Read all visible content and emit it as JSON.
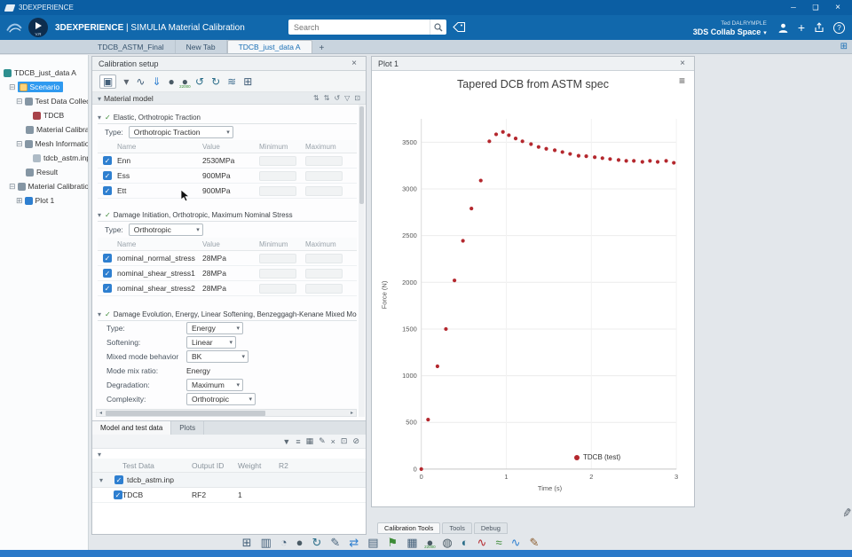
{
  "titlebar": {
    "title": "3DEXPERIENCE"
  },
  "header": {
    "brand": "3DEXPERIENCE",
    "separator": "|",
    "app_name": "SIMULIA Material Calibration",
    "compass_label": "V.R",
    "search_placeholder": "Search",
    "user_name": "Ted DALRYMPLE",
    "space_name": "3DS Collab Space"
  },
  "tabbar": {
    "tabs": [
      {
        "label": "TDCB_ASTM_Final"
      },
      {
        "label": "New Tab"
      },
      {
        "label": "TDCB_just_data A"
      }
    ],
    "new_tab_label": "+"
  },
  "tree": {
    "items": [
      {
        "label": "TDCB_just_data A"
      },
      {
        "label": "Scenario"
      },
      {
        "label": "Test Data Collector..."
      },
      {
        "label": "TDCB"
      },
      {
        "label": "Material Calibration"
      },
      {
        "label": "Mesh Information C..."
      },
      {
        "label": "tdcb_astm.inp"
      },
      {
        "label": "Result"
      },
      {
        "label": "Material Calibration"
      },
      {
        "label": "Plot 1"
      }
    ]
  },
  "calibration": {
    "panel_title": "Calibration setup",
    "toolbar_icons": [
      {
        "name": "view-mode-selector-icon",
        "glyph": "▣",
        "color": "#44607a"
      },
      {
        "name": "view-mode-caret-icon",
        "glyph": "▾",
        "color": "#5d6670"
      },
      {
        "name": "plot-tool-icon",
        "glyph": "∿",
        "color": "#44607a"
      },
      {
        "name": "import-data-icon",
        "glyph": "⇓",
        "color": "#2e7fd0"
      },
      {
        "name": "mesh-sphere-icon",
        "glyph": "●",
        "color": "#4a5b66"
      },
      {
        "name": "mesh-count-icon",
        "glyph": "●",
        "color": "#4a5b66",
        "badge": "22000"
      },
      {
        "name": "undo-icon",
        "glyph": "↺",
        "color": "#2c6e8a"
      },
      {
        "name": "redo-icon",
        "glyph": "↻",
        "color": "#2c6e8a"
      },
      {
        "name": "create-plot-icon",
        "glyph": "≋",
        "color": "#3d6c8e"
      },
      {
        "name": "data-table-icon",
        "glyph": "⊞",
        "color": "#44607a"
      }
    ],
    "material_model_label": "Material model",
    "material_model_icons": [
      {
        "name": "sort-ascending-icon",
        "glyph": "⇅"
      },
      {
        "name": "sort-descending-icon",
        "glyph": "⇅"
      },
      {
        "name": "reset-icon",
        "glyph": "↺"
      },
      {
        "name": "filter-icon",
        "glyph": "▽"
      },
      {
        "name": "copy-icon",
        "glyph": "⊡"
      }
    ],
    "elastic": {
      "title": "Elastic, Orthotropic Traction",
      "type_label": "Type:",
      "type_value": "Orthotropic Traction",
      "columns": [
        "Name",
        "Value",
        "Minimum",
        "Maximum"
      ],
      "rows": [
        {
          "name": "Enn",
          "value": "2530MPa"
        },
        {
          "name": "Ess",
          "value": "900MPa"
        },
        {
          "name": "Ett",
          "value": "900MPa"
        }
      ]
    },
    "damage_initiation": {
      "title": "Damage Initiation, Orthotropic, Maximum Nominal Stress",
      "type_label": "Type:",
      "type_value": "Orthotropic",
      "columns": [
        "Name",
        "Value",
        "Minimum",
        "Maximum"
      ],
      "rows": [
        {
          "name": "nominal_normal_stress",
          "value": "28MPa"
        },
        {
          "name": "nominal_shear_stress1",
          "value": "28MPa"
        },
        {
          "name": "nominal_shear_stress2",
          "value": "28MPa"
        }
      ]
    },
    "damage_evolution": {
      "title": "Damage Evolution, Energy, Linear Softening, Benzeggagh-Kenane Mixed Mode",
      "fields": [
        {
          "label": "Type:",
          "value": "Energy",
          "control": "select"
        },
        {
          "label": "Softening:",
          "value": "Linear",
          "control": "select"
        },
        {
          "label": "Mixed mode behavior",
          "value": "BK",
          "control": "select"
        },
        {
          "label": "Mode mix ratio:",
          "value": "Energy",
          "control": "text"
        },
        {
          "label": "Degradation:",
          "value": "Maximum",
          "control": "select"
        },
        {
          "label": "Complexity:",
          "value": "Orthotropic",
          "control": "select"
        }
      ]
    },
    "subpanel": {
      "tabs": [
        {
          "label": "Model and test data"
        },
        {
          "label": "Plots"
        }
      ],
      "toolbar_icons": [
        {
          "name": "filter-icon",
          "glyph": "▼"
        },
        {
          "name": "list-icon",
          "glyph": "≡"
        },
        {
          "name": "grid-icon",
          "glyph": "▦"
        },
        {
          "name": "edit-icon",
          "glyph": "✎"
        },
        {
          "name": "remove-icon",
          "glyph": "×"
        },
        {
          "name": "copy-icon",
          "glyph": "⊡"
        },
        {
          "name": "delete-icon",
          "glyph": "⊘"
        }
      ],
      "table": {
        "columns": [
          "Test Data",
          "Output ID",
          "Weight",
          "R2"
        ],
        "group_row": {
          "name": "tdcb_astm.inp"
        },
        "rows": [
          {
            "name": "TDCB",
            "output_id": "RF2",
            "weight": "1",
            "r2": ""
          }
        ]
      }
    }
  },
  "plot_panel": {
    "title": "Plot 1"
  },
  "chart_data": {
    "type": "scatter",
    "title": "Tapered DCB from ASTM spec",
    "xlabel": "Time (s)",
    "ylabel": "Force (N)",
    "xlim": [
      0,
      3
    ],
    "ylim": [
      0,
      3750
    ],
    "xticks": [
      0,
      1,
      2,
      3
    ],
    "yticks": [
      0,
      500,
      1000,
      1500,
      2000,
      2500,
      3000,
      3500
    ],
    "grid": true,
    "legend": {
      "position": "inside-bottom",
      "label": "TDCB (test)"
    },
    "series": [
      {
        "name": "TDCB (test)",
        "color": "#b4282e",
        "marker": "circle",
        "points": [
          [
            0,
            0
          ],
          [
            0.08,
            530
          ],
          [
            0.19,
            1100
          ],
          [
            0.29,
            1500
          ],
          [
            0.39,
            2020
          ],
          [
            0.49,
            2445
          ],
          [
            0.59,
            2790
          ],
          [
            0.7,
            3090
          ],
          [
            0.8,
            3510
          ],
          [
            0.88,
            3585
          ],
          [
            0.96,
            3610
          ],
          [
            1.03,
            3575
          ],
          [
            1.11,
            3540
          ],
          [
            1.19,
            3510
          ],
          [
            1.29,
            3480
          ],
          [
            1.38,
            3450
          ],
          [
            1.47,
            3430
          ],
          [
            1.57,
            3415
          ],
          [
            1.66,
            3395
          ],
          [
            1.75,
            3375
          ],
          [
            1.85,
            3355
          ],
          [
            1.94,
            3350
          ],
          [
            2.04,
            3340
          ],
          [
            2.13,
            3330
          ],
          [
            2.22,
            3320
          ],
          [
            2.32,
            3310
          ],
          [
            2.41,
            3300
          ],
          [
            2.5,
            3300
          ],
          [
            2.6,
            3290
          ],
          [
            2.69,
            3300
          ],
          [
            2.78,
            3290
          ],
          [
            2.88,
            3300
          ],
          [
            2.97,
            3280
          ]
        ]
      }
    ]
  },
  "bottom": {
    "tabs": [
      {
        "label": "Calibration Tools"
      },
      {
        "label": "Tools"
      },
      {
        "label": "Debug"
      }
    ],
    "toolbar_icons": [
      {
        "name": "table-icon",
        "glyph": "⊞",
        "color": "#44607a"
      },
      {
        "name": "chart-icon",
        "glyph": "▥",
        "color": "#44607a"
      },
      {
        "name": "gauge-icon",
        "glyph": "◔",
        "color": "#44607a"
      },
      {
        "name": "sphere-icon",
        "glyph": "●",
        "color": "#4a5b66"
      },
      {
        "name": "refresh-icon",
        "glyph": "↻",
        "color": "#2c6e8a"
      },
      {
        "name": "annotate-chart-icon",
        "glyph": "✎",
        "color": "#44607a"
      },
      {
        "name": "transfer-icon",
        "glyph": "⇄",
        "color": "#2e7fd0"
      },
      {
        "name": "report-icon",
        "glyph": "▤",
        "color": "#44607a"
      },
      {
        "name": "flag-icon",
        "glyph": "⚑",
        "color": "#3d8b37"
      },
      {
        "name": "matrix-icon",
        "glyph": "▦",
        "color": "#44607a"
      },
      {
        "name": "mesh-count-icon",
        "glyph": "●",
        "color": "#4a5b66",
        "badge": "22000"
      },
      {
        "name": "sphere2-icon",
        "glyph": "◍",
        "color": "#4a5b66"
      },
      {
        "name": "globe-icon",
        "glyph": "◐",
        "color": "#2c6e8a"
      },
      {
        "name": "curve-red-icon",
        "glyph": "∿",
        "color": "#b4282e"
      },
      {
        "name": "curves-green-icon",
        "glyph": "≈",
        "color": "#3d8b37"
      },
      {
        "name": "curve-blue-icon",
        "glyph": "∿",
        "color": "#2e7fd0"
      },
      {
        "name": "draw-curve-icon",
        "glyph": "✎",
        "color": "#8a5a2a"
      }
    ]
  }
}
